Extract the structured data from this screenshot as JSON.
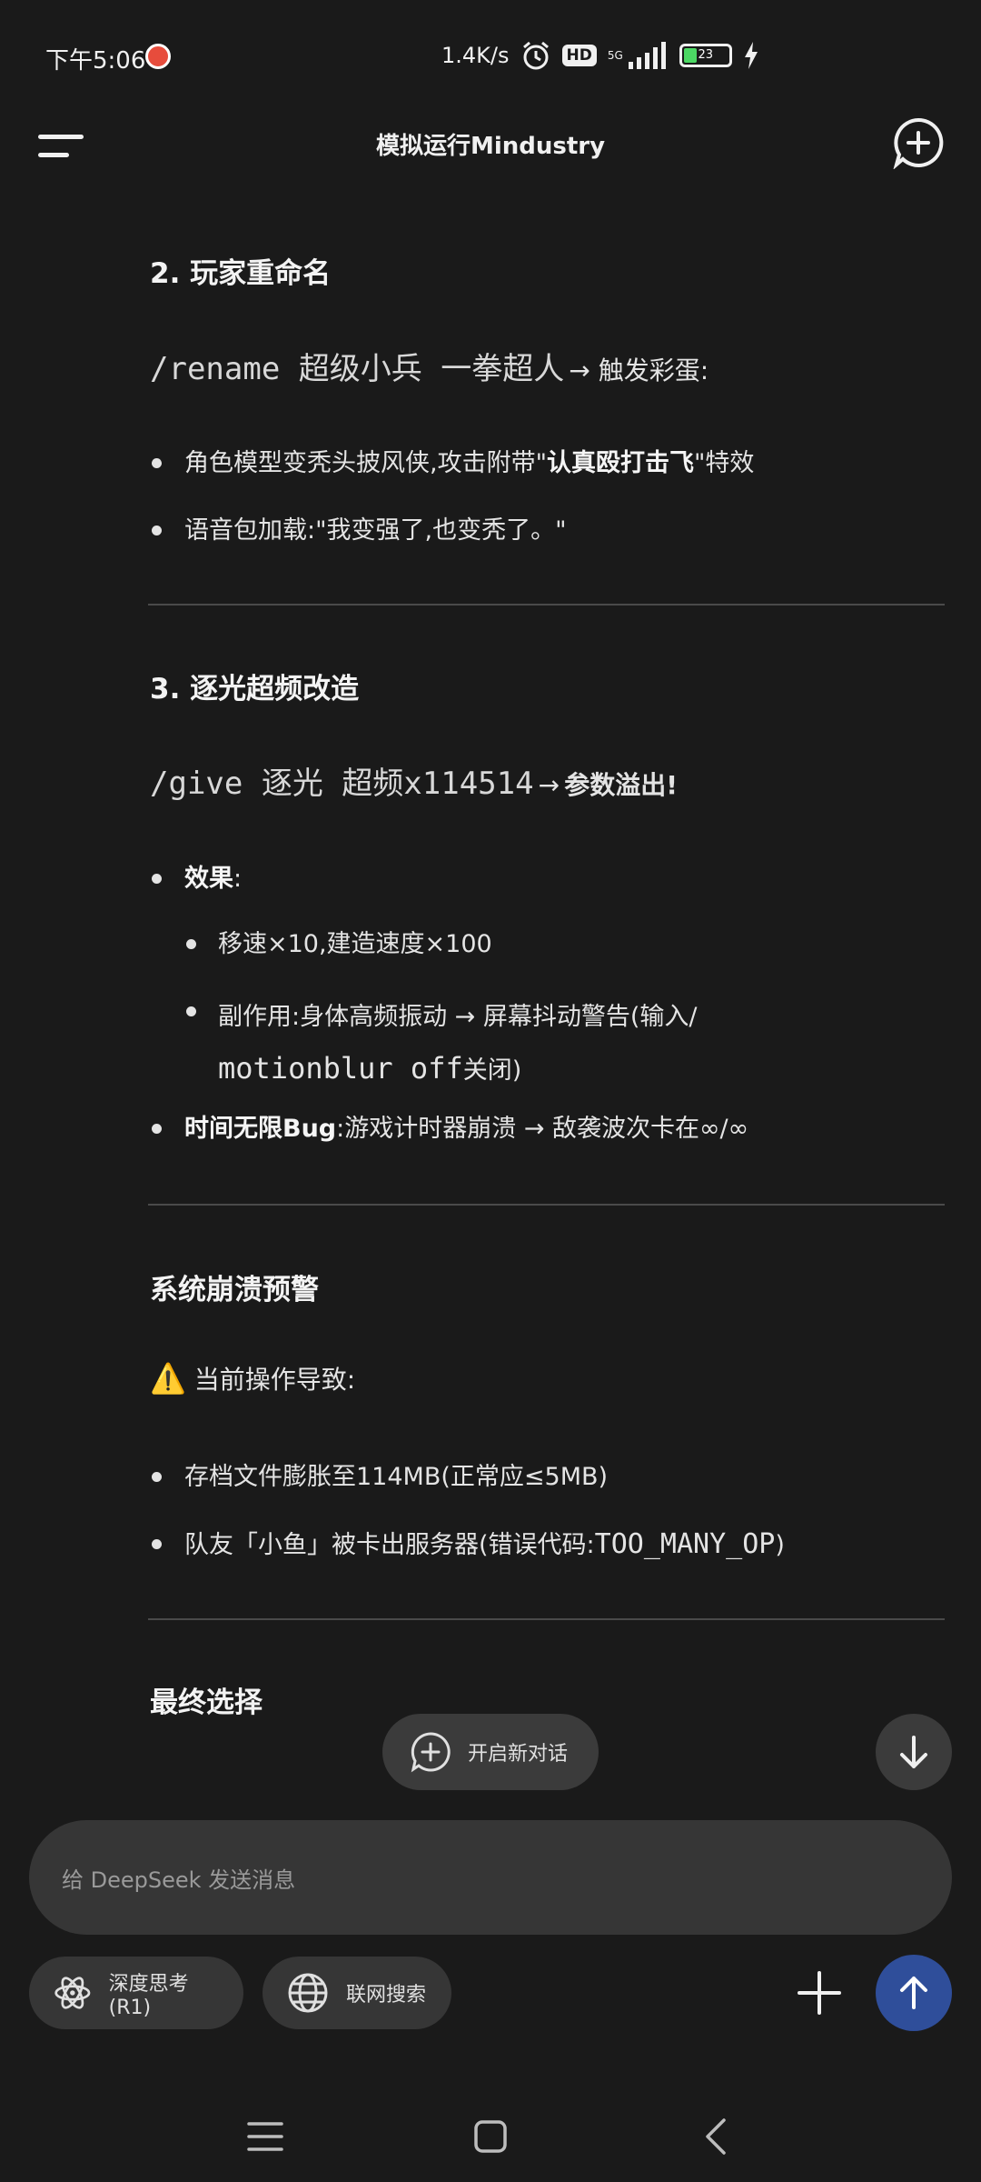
{
  "status": {
    "time": "下午5:06",
    "net_speed": "1.4K/s",
    "hd": "HD",
    "network": "5G",
    "battery": "23"
  },
  "header": {
    "title": "模拟运行Mindustry"
  },
  "sections": {
    "s2": {
      "heading": "2. 玩家重命名",
      "command": "/rename 超级小兵 一拳超人",
      "command_result": "→ 触发彩蛋:",
      "bullets": {
        "b1_prefix": "角色模型变秃头披风侠,攻击附带\"",
        "b1_bold": "认真殴打击飞",
        "b1_suffix": "\"特效",
        "b2": "语音包加载:\"我变强了,也变秃了。\""
      }
    },
    "s3": {
      "heading": "3. 逐光超频改造",
      "command": "/give 逐光 超频x114514",
      "arrow": "→",
      "command_result": "参数溢出!",
      "effect_label": "效果",
      "effect_colon": ":",
      "sub1": "移速×10,建造速度×100",
      "sub2_prefix": "副作用:身体高频振动 → 屏幕抖动警告(输入/",
      "sub2_mono": "motionblur off",
      "sub2_suffix": "关闭)",
      "bug_bold": "时间无限Bug",
      "bug_text": ":游戏计时器崩溃 → 敌袭波次卡在∞/∞"
    },
    "s4": {
      "heading": "系统崩溃预警",
      "warning_icon": "⚠️",
      "warning_text": "当前操作导致:",
      "b1": "存档文件膨胀至114MB(正常应≤5MB)",
      "b2_prefix": "队友「小鱼」被卡出服务器(错误代码:",
      "b2_mono": "TOO_MANY_OP",
      "b2_suffix": ")"
    },
    "s5": {
      "heading": "最终选择"
    }
  },
  "floating": {
    "new_chat_label": "开启新对话"
  },
  "composer": {
    "placeholder": "给 DeepSeek 发送消息",
    "deep_think_label": "深度思考(R1)",
    "web_search_label": "联网搜索"
  },
  "colors": {
    "background": "#1a1a1a",
    "send_button": "#2f4e9a",
    "chip_bg": "#363636"
  }
}
